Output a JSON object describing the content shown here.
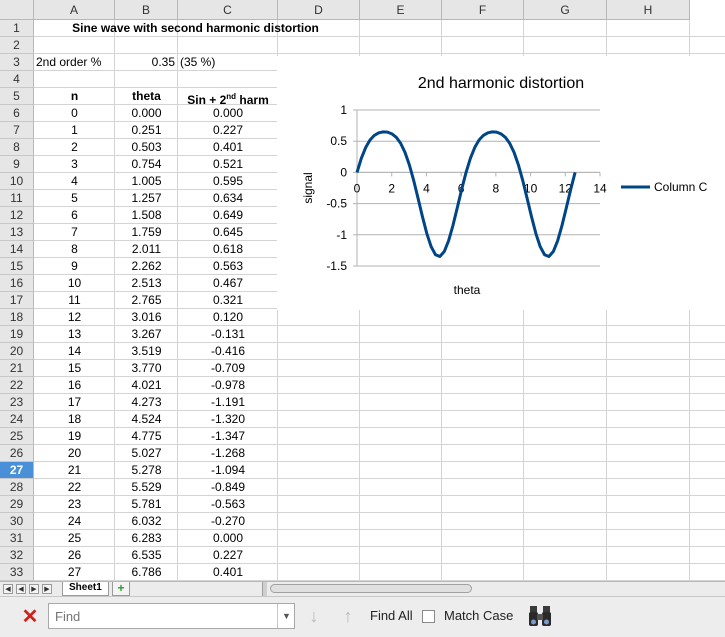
{
  "columns": [
    "A",
    "B",
    "C",
    "D",
    "E",
    "F",
    "G",
    "H"
  ],
  "rows": [
    "1",
    "2",
    "3",
    "4",
    "5",
    "6",
    "7",
    "8",
    "9",
    "10",
    "11",
    "12",
    "13",
    "14",
    "15",
    "16",
    "17",
    "18",
    "19",
    "20",
    "21",
    "22",
    "23",
    "24",
    "25",
    "26",
    "27",
    "28",
    "29",
    "30",
    "31",
    "32",
    "33"
  ],
  "active_row": "27",
  "cells": {
    "title": "Sine wave with second harmonic distortion",
    "a3": "2nd order %",
    "b3": "0.35",
    "c3": "(35 %)",
    "hdr_n": "n",
    "hdr_theta": "theta",
    "hdr_c_main": "Sin + 2",
    "hdr_c_sup": "nd",
    "hdr_c_tail": " harm"
  },
  "table": {
    "n": [
      "0",
      "1",
      "2",
      "3",
      "4",
      "5",
      "6",
      "7",
      "8",
      "9",
      "10",
      "11",
      "12",
      "13",
      "14",
      "15",
      "16",
      "17",
      "18",
      "19",
      "20",
      "21",
      "22",
      "23",
      "24",
      "25",
      "26",
      "27"
    ],
    "theta": [
      "0.000",
      "0.251",
      "0.503",
      "0.754",
      "1.005",
      "1.257",
      "1.508",
      "1.759",
      "2.011",
      "2.262",
      "2.513",
      "2.765",
      "3.016",
      "3.267",
      "3.519",
      "3.770",
      "4.021",
      "4.273",
      "4.524",
      "4.775",
      "5.027",
      "5.278",
      "5.529",
      "5.781",
      "6.032",
      "6.283",
      "6.535",
      "6.786"
    ],
    "signal": [
      "0.000",
      "0.227",
      "0.401",
      "0.521",
      "0.595",
      "0.634",
      "0.649",
      "0.645",
      "0.618",
      "0.563",
      "0.467",
      "0.321",
      "0.120",
      "-0.131",
      "-0.416",
      "-0.709",
      "-0.978",
      "-1.191",
      "-1.320",
      "-1.347",
      "-1.268",
      "-1.094",
      "-0.849",
      "-0.563",
      "-0.270",
      "0.000",
      "0.227",
      "0.401"
    ]
  },
  "chart_data": {
    "type": "line",
    "title": "2nd harmonic distortion",
    "xlabel": "theta",
    "ylabel": "signal",
    "xlim": [
      0,
      14
    ],
    "ylim": [
      -1.5,
      1
    ],
    "xticks": [
      "0",
      "2",
      "4",
      "6",
      "8",
      "10",
      "12",
      "14"
    ],
    "yticks": [
      "1",
      "0.5",
      "0",
      "-0.5",
      "-1",
      "-1.5"
    ],
    "grid": true,
    "legend": "right",
    "series": [
      {
        "name": "Column C",
        "color": "#004586",
        "x": [
          0.0,
          0.251,
          0.503,
          0.754,
          1.005,
          1.257,
          1.508,
          1.759,
          2.011,
          2.262,
          2.513,
          2.765,
          3.016,
          3.267,
          3.519,
          3.77,
          4.021,
          4.273,
          4.524,
          4.775,
          5.027,
          5.278,
          5.529,
          5.781,
          6.032,
          6.283,
          6.535,
          6.786,
          7.037,
          7.288,
          7.54,
          7.791,
          8.042,
          8.294,
          8.545,
          8.796,
          9.048,
          9.299,
          9.55,
          9.802,
          10.053,
          10.304,
          10.556,
          10.807,
          11.058,
          11.31,
          11.561,
          11.812,
          12.064,
          12.315,
          12.566
        ],
        "y": [
          0.0,
          0.227,
          0.401,
          0.521,
          0.595,
          0.634,
          0.649,
          0.645,
          0.618,
          0.563,
          0.467,
          0.321,
          0.12,
          -0.131,
          -0.416,
          -0.709,
          -0.978,
          -1.191,
          -1.32,
          -1.347,
          -1.268,
          -1.094,
          -0.849,
          -0.563,
          -0.27,
          0.0,
          0.227,
          0.401,
          0.521,
          0.595,
          0.634,
          0.649,
          0.645,
          0.618,
          0.563,
          0.467,
          0.321,
          0.12,
          -0.131,
          -0.416,
          -0.709,
          -0.978,
          -1.191,
          -1.32,
          -1.347,
          -1.268,
          -1.094,
          -0.849,
          -0.563,
          -0.27,
          0.0
        ]
      }
    ]
  },
  "sheet_tab": "Sheet1",
  "find": {
    "placeholder": "Find",
    "find_all": "Find All",
    "match_case": "Match Case"
  },
  "icons": {
    "close": "close-icon",
    "down": "arrow-down-icon",
    "up": "arrow-up-icon",
    "binoculars": "binoculars-icon"
  }
}
